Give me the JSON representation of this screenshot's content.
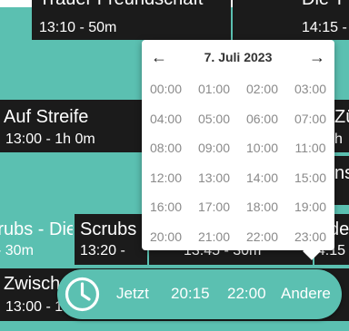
{
  "schedule": {
    "row1": [
      {
        "title": "Trauer Freundschaft",
        "time": "13:10 - 50m"
      },
      {
        "title": "Die T",
        "time": "14:15 -"
      }
    ],
    "row2": [
      {
        "title": "Auf Streife",
        "time": "13:00 - 1h 0m"
      },
      {
        "title": "Zü",
        "time": "h"
      }
    ],
    "row3_right": {
      "title": "ns"
    },
    "row4": [
      {
        "title": "Scrubs - Die",
        "time": "- 30m"
      },
      {
        "title": "Scrubs",
        "time": "13:20 -"
      },
      {
        "title": "",
        "time": "13:45 - 30m"
      },
      {
        "title": "de",
        "time": "14:15 -"
      }
    ],
    "row5": [
      {
        "title": "Zwisch",
        "time": "13:00 - 1"
      }
    ]
  },
  "picker": {
    "date": "7. Juli 2023",
    "prev": "←",
    "next": "→",
    "times": [
      "00:00",
      "01:00",
      "02:00",
      "03:00",
      "04:00",
      "05:00",
      "06:00",
      "07:00",
      "08:00",
      "09:00",
      "10:00",
      "11:00",
      "12:00",
      "13:00",
      "14:00",
      "15:00",
      "16:00",
      "17:00",
      "18:00",
      "19:00",
      "20:00",
      "21:00",
      "22:00",
      "23:00"
    ]
  },
  "quickbar": {
    "icon": "clock-icon",
    "now": "Jetzt",
    "t1": "20:15",
    "t2": "22:00",
    "other": "Andere"
  },
  "colors": {
    "accent": "#5bc0b1",
    "cell": "#1b1b1b"
  }
}
